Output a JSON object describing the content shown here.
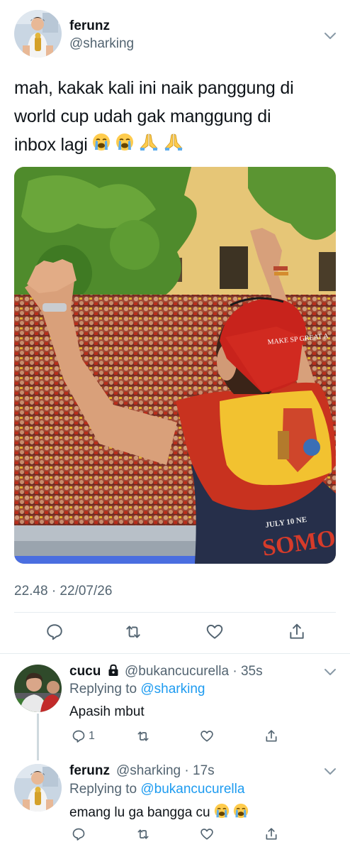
{
  "tweet": {
    "display_name": "ferunz",
    "handle": "@sharking",
    "text_line1": "mah, kakak kali ini naik panggung di",
    "text_line2": "world cup udah gak manggung di",
    "text_line3": "inbox lagi",
    "emojis": [
      "loudly-crying-face",
      "loudly-crying-face",
      "folded-hands",
      "folded-hands"
    ],
    "timestamp": "22.48 · 22/07/26",
    "image_text_cap": "MAKE SP GREAT A",
    "image_text_shirt": "SOMO",
    "image_text_shirt_small": "JULY 10 NE"
  },
  "replies": [
    {
      "display_name": "cucu",
      "handle": "@bukancucurella",
      "time": "· 35s",
      "replying_label": "Replying to",
      "replying_to": "@sharking",
      "text": "Apasih mbut",
      "reply_count": "1"
    },
    {
      "display_name": "ferunz",
      "handle": "@sharking",
      "time": "· 17s",
      "replying_label": "Replying to",
      "replying_to": "@bukancucurella",
      "text": "emang lu ga bangga cu",
      "emojis": [
        "loudly-crying-face",
        "loudly-crying-face"
      ]
    }
  ],
  "colors": {
    "accent": "#1d9bf0",
    "secondary_text": "#536471",
    "divider": "#e6ecf0"
  }
}
